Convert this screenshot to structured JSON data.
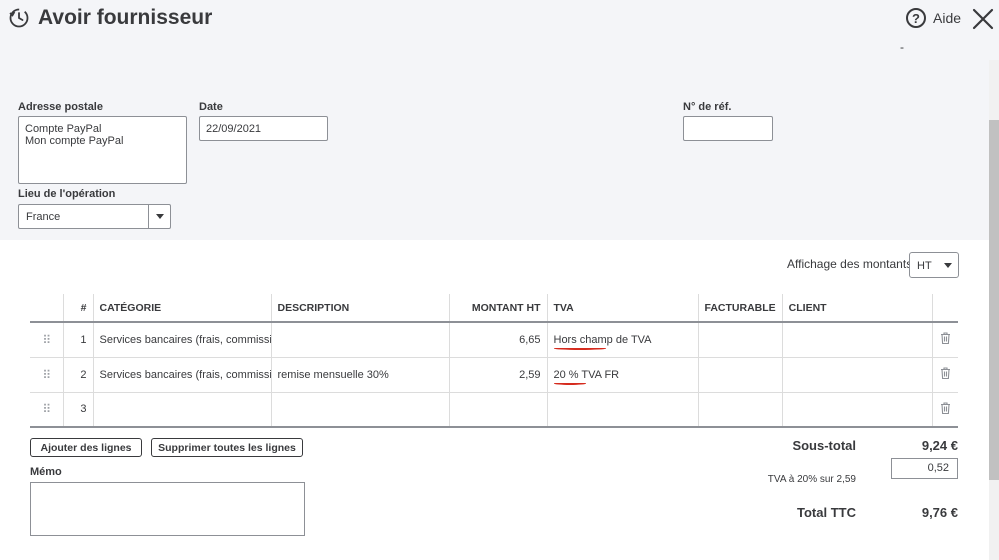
{
  "header": {
    "title": "Avoir fournisseur",
    "help_label": "Aide",
    "dash": "-"
  },
  "form": {
    "address_label": "Adresse postale",
    "address_lines": [
      "Compte PayPal",
      "Mon compte PayPal"
    ],
    "date_label": "Date",
    "date_value": "22/09/2021",
    "ref_label": "N° de réf.",
    "ref_value": "",
    "place_label": "Lieu de l'opération",
    "place_value": "France"
  },
  "amounts": {
    "label": "Affichage des montants",
    "value": "HT"
  },
  "table": {
    "columns": [
      "",
      "#",
      "CATÉGORIE",
      "DESCRIPTION",
      "MONTANT HT",
      "TVA",
      "FACTURABLE",
      "CLIENT",
      ""
    ],
    "rows": [
      {
        "num": "1",
        "category": "Services bancaires (frais, commission",
        "description": "",
        "amount": "6,65",
        "tva": "Hors champ de TVA",
        "billable": "",
        "client": ""
      },
      {
        "num": "2",
        "category": "Services bancaires (frais, commission",
        "description": "remise mensuelle 30%",
        "amount": "2,59",
        "tva": "20 % TVA FR",
        "billable": "",
        "client": ""
      },
      {
        "num": "3",
        "category": "",
        "description": "",
        "amount": "",
        "tva": "",
        "billable": "",
        "client": ""
      }
    ]
  },
  "buttons": {
    "add_lines": "Ajouter des lignes",
    "delete_lines": "Supprimer toutes les lignes"
  },
  "memo": {
    "label": "Mémo",
    "value": ""
  },
  "totals": {
    "subtotal_label": "Sous-total",
    "subtotal_value": "9,24 €",
    "tva_label": "TVA à 20% sur 2,59",
    "tva_value": "0,52",
    "total_label": "Total TTC",
    "total_value": "9,76 €"
  },
  "colors": {
    "annotation": "#d52b1e"
  }
}
